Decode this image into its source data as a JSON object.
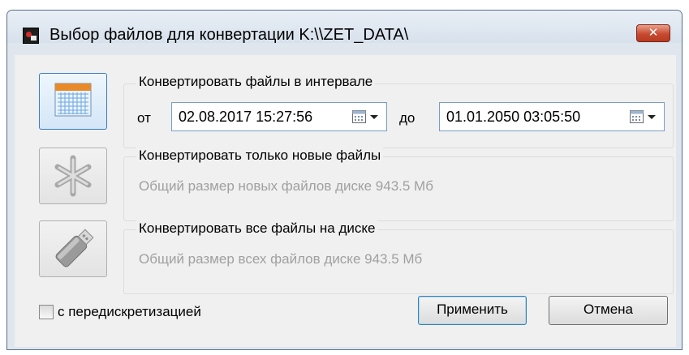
{
  "window": {
    "title": "Выбор файлов для конвертации K:\\\\ZET_DATA\\",
    "close_label": "✕"
  },
  "interval": {
    "caption": "Конвертировать файлы в интервале",
    "from_label": "от",
    "from_value": "02.08.2017 15:27:56",
    "to_label": "до",
    "to_value": "01.01.2050 03:05:50"
  },
  "new_files": {
    "caption": "Конвертировать только новые файлы",
    "info": "Общий размер новых файлов диске  943.5 Мб"
  },
  "all_files": {
    "caption": "Конвертировать все файлы на диске",
    "info": "Общий размер всех файлов диске  943.5 Мб"
  },
  "options": {
    "resample_label": "с передискретизацией",
    "resample_checked": false
  },
  "buttons": {
    "apply": "Применить",
    "cancel": "Отмена"
  },
  "icons": {
    "interval": "calendar-icon",
    "new_files": "asterisk-icon",
    "all_files": "usb-drive-icon"
  },
  "colors": {
    "accent": "#3a7bc8",
    "close_button": "#c74a30",
    "disabled_text": "#a0a0a0"
  }
}
